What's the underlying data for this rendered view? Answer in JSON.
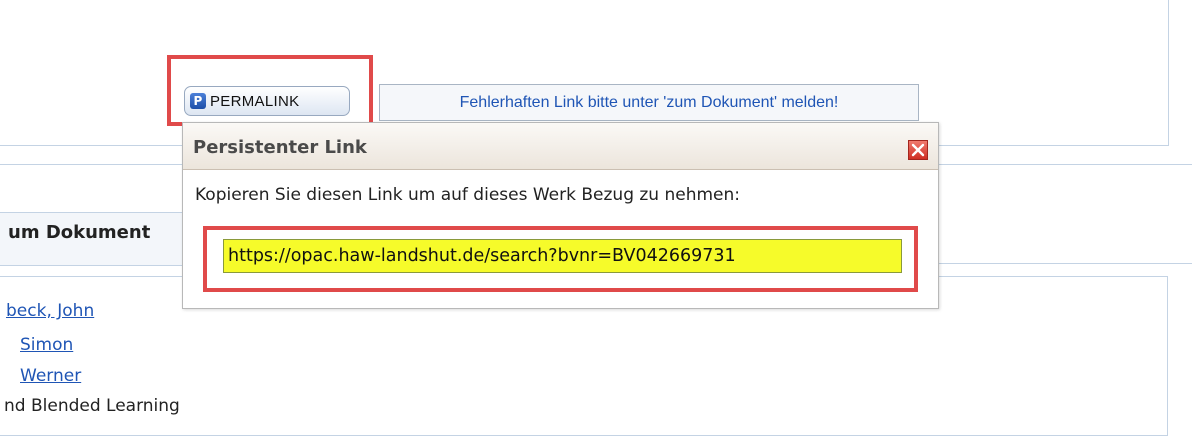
{
  "toolbar": {
    "permalink_label": "PERMALINK",
    "permalink_icon_letter": "P",
    "report_link_label": "Fehlerhaften Link bitte unter 'zum Dokument' melden!"
  },
  "popup": {
    "title": "Persistenter Link",
    "description": "Kopieren Sie diesen Link um auf dieses Werk Bezug zu nehmen:",
    "url_value": "https://opac.haw-landshut.de/search?bvnr=BV042669731",
    "close_icon": "close-icon"
  },
  "background": {
    "tab_label": "um Dokument",
    "authors": [
      {
        "label": "beck, John"
      },
      {
        "label": "Simon"
      },
      {
        "label": "Werner"
      }
    ],
    "title_fragment": "nd Blended Learning"
  },
  "colors": {
    "annotation_red": "#e04a4a",
    "url_highlight": "#f6fb2a",
    "link_blue": "#1f55b5"
  }
}
